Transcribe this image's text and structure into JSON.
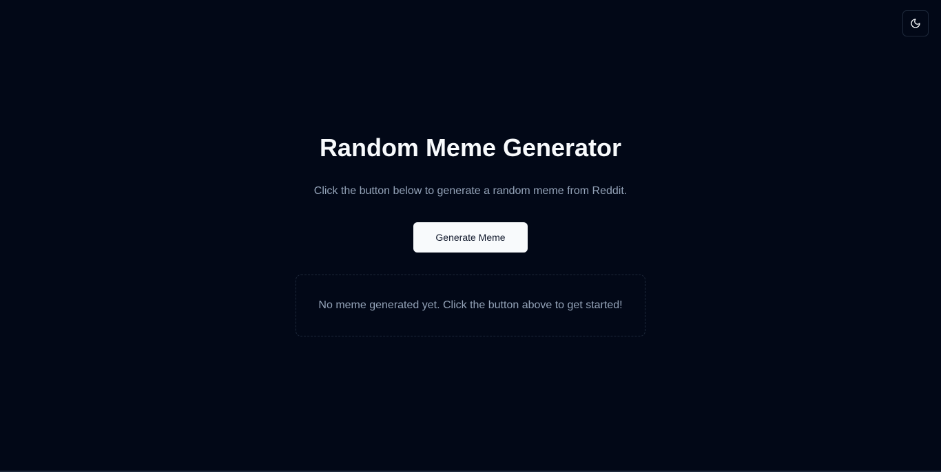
{
  "theme_toggle": {
    "icon": "moon-icon",
    "icon_color": "#f8fafc"
  },
  "header": {
    "title": "Random Meme Generator",
    "subtitle": "Click the button below to generate a random meme from Reddit."
  },
  "actions": {
    "generate_label": "Generate Meme"
  },
  "meme_display": {
    "empty_text": "No meme generated yet. Click the button above to get started!"
  },
  "colors": {
    "background": "#020817",
    "foreground": "#f8fafc",
    "muted_text": "#94a3b8",
    "border": "#1e293b",
    "button_bg": "#f8fafc",
    "button_text": "#0f172a"
  }
}
